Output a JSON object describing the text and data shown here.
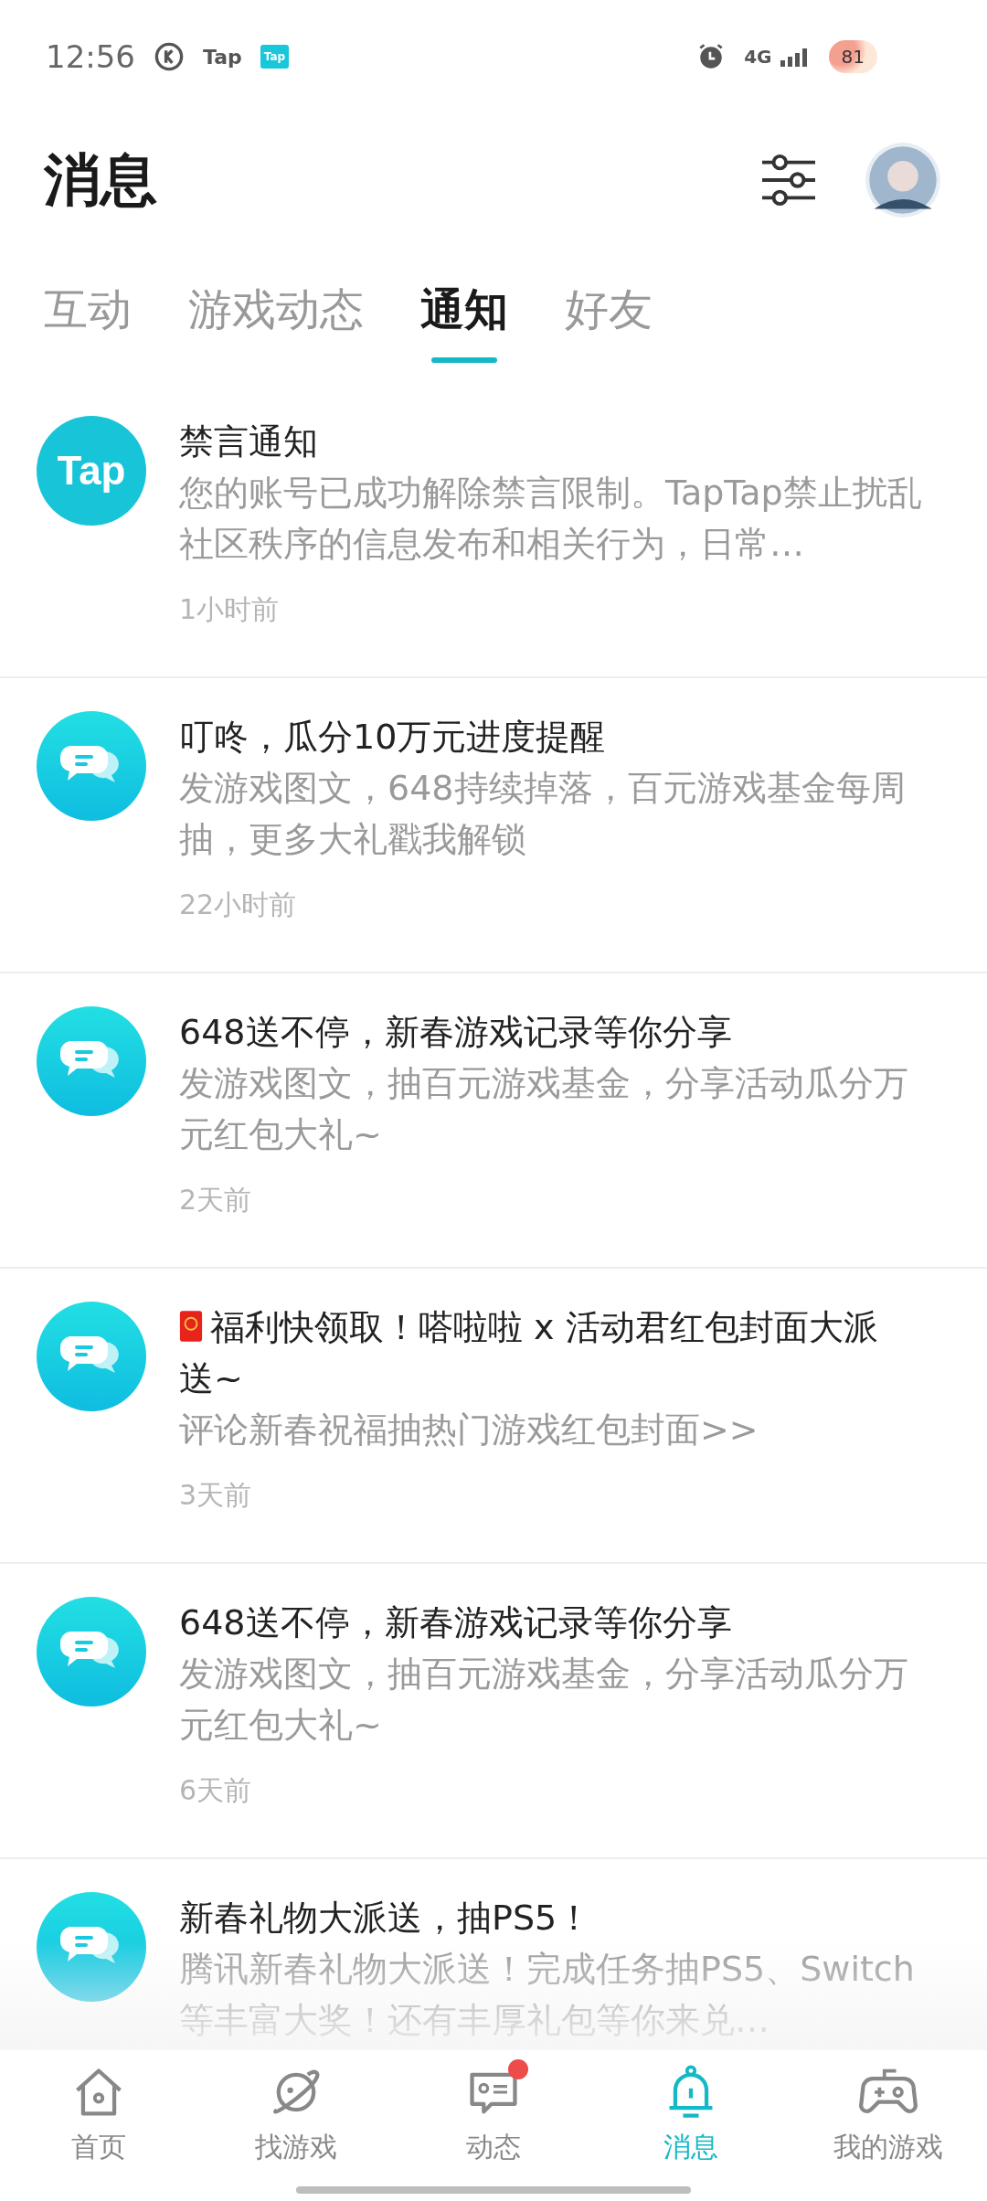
{
  "status_bar": {
    "time": "12:56",
    "app_label": "Tap",
    "app_badge": "Tap",
    "network": "4G",
    "battery": "81"
  },
  "header": {
    "title": "消息"
  },
  "tabs": [
    {
      "label": "互动",
      "selected": false
    },
    {
      "label": "游戏动态",
      "selected": false
    },
    {
      "label": "通知",
      "selected": true
    },
    {
      "label": "好友",
      "selected": false
    }
  ],
  "notifications": [
    {
      "kind": "tap",
      "logo": "Tap",
      "title": "禁言通知",
      "body": "您的账号已成功解除禁言限制。TapTap禁止扰乱社区秩序的信息发布和相关行为，日常…",
      "time": "1小时前"
    },
    {
      "kind": "chat",
      "title": "叮咚，瓜分10万元进度提醒",
      "body": "发游戏图文，648持续掉落，百元游戏基金每周抽，更多大礼戳我解锁",
      "time": "22小时前"
    },
    {
      "kind": "chat",
      "title": "648送不停，新春游戏记录等你分享",
      "body": "发游戏图文，抽百元游戏基金，分享活动瓜分万元红包大礼~",
      "time": "2天前"
    },
    {
      "kind": "chat",
      "envelope": true,
      "title": "福利快领取！嗒啦啦 x 活动君红包封面大派送~",
      "body": "评论新春祝福抽热门游戏红包封面>>",
      "time": "3天前"
    },
    {
      "kind": "chat",
      "title": "648送不停，新春游戏记录等你分享",
      "body": "发游戏图文，抽百元游戏基金，分享活动瓜分万元红包大礼~",
      "time": "6天前"
    },
    {
      "kind": "chat",
      "title": "新春礼物大派送，抽PS5！",
      "body": "腾讯新春礼物大派送！完成任务抽PS5、Switch等丰富大奖！还有丰厚礼包等你来兑…"
    }
  ],
  "bottom_nav": [
    {
      "kind": "home",
      "label": "首页",
      "selected": false,
      "badge": false
    },
    {
      "kind": "explore",
      "label": "找游戏",
      "selected": false,
      "badge": false
    },
    {
      "kind": "feed",
      "label": "动态",
      "selected": false,
      "badge": true
    },
    {
      "kind": "bell",
      "label": "消息",
      "selected": true,
      "badge": false
    },
    {
      "kind": "gamepad",
      "label": "我的游戏",
      "selected": false,
      "badge": false
    }
  ]
}
